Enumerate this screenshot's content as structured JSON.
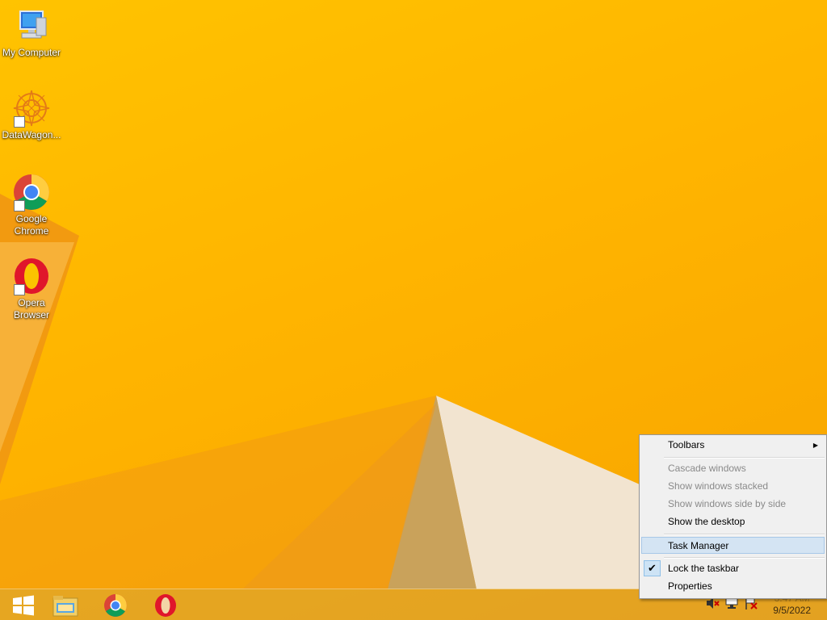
{
  "desktop": {
    "icons": [
      {
        "name": "My Computer",
        "shortcut": false
      },
      {
        "name": "DataWagon...",
        "shortcut": true
      },
      {
        "name": "Google Chrome",
        "shortcut": true
      },
      {
        "name": "Opera Browser",
        "shortcut": true
      }
    ]
  },
  "taskbar": {
    "start_icon": "windows-logo-icon",
    "pinned": [
      "file-explorer-icon",
      "chrome-icon",
      "opera-icon"
    ],
    "tray": [
      "speaker-muted-icon",
      "network-icon",
      "action-center-flag-icon"
    ],
    "clock": {
      "time": "3:47 AM",
      "date": "9/5/2022"
    }
  },
  "context_menu": {
    "toolbars": "Toolbars",
    "cascade": "Cascade windows",
    "stacked": "Show windows stacked",
    "side_by_side": "Show windows side by side",
    "show_desktop": "Show the desktop",
    "task_manager": "Task Manager",
    "lock_taskbar": "Lock the taskbar",
    "properties": "Properties"
  },
  "colors": {
    "wallpaper": "#ffb400",
    "menu_highlight": "#d4e4f3"
  }
}
